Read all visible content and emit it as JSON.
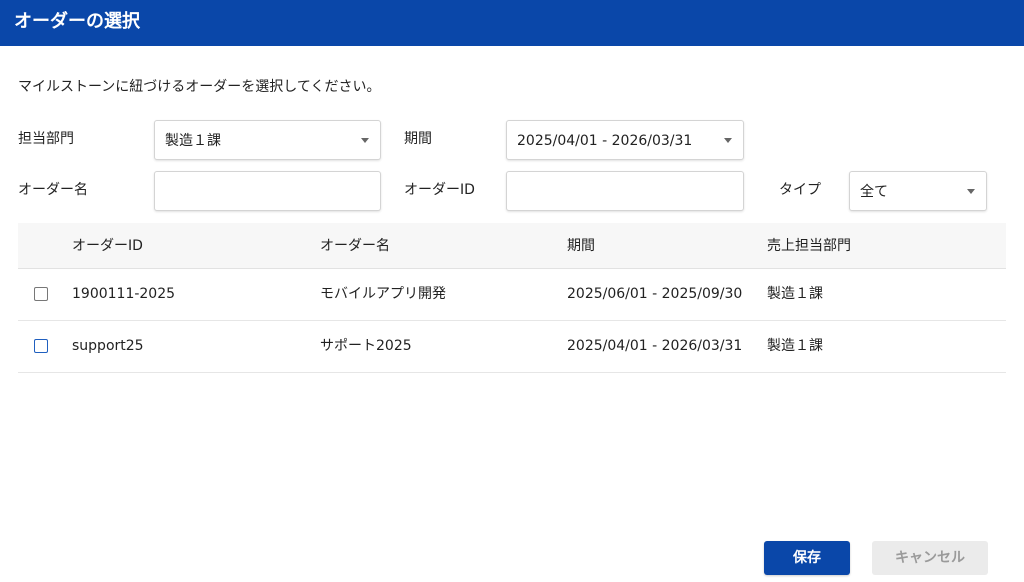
{
  "dialog": {
    "title": "オーダーの選択",
    "instruction": "マイルストーンに紐づけるオーダーを選択してください。"
  },
  "filters": {
    "department": {
      "label": "担当部門",
      "value": "製造１課"
    },
    "period": {
      "label": "期間",
      "value": "2025/04/01 - 2026/03/31"
    },
    "order_name": {
      "label": "オーダー名",
      "value": ""
    },
    "order_id": {
      "label": "オーダーID",
      "value": ""
    },
    "type": {
      "label": "タイプ",
      "value": "全て"
    }
  },
  "table": {
    "headers": {
      "order_id": "オーダーID",
      "order_name": "オーダー名",
      "period": "期間",
      "dept": "売上担当部門"
    },
    "rows": [
      {
        "order_id": "1900111-2025",
        "order_name": "モバイルアプリ開発",
        "period": "2025/06/01 - 2025/09/30",
        "dept": "製造１課",
        "checked": false
      },
      {
        "order_id": "support25",
        "order_name": "サポート2025",
        "period": "2025/04/01 - 2026/03/31",
        "dept": "製造１課",
        "checked": false
      }
    ]
  },
  "buttons": {
    "save": "保存",
    "cancel": "キャンセル"
  },
  "colors": {
    "accent": "#0a47a9",
    "checkbox_highlight": "#1f5fbf"
  }
}
